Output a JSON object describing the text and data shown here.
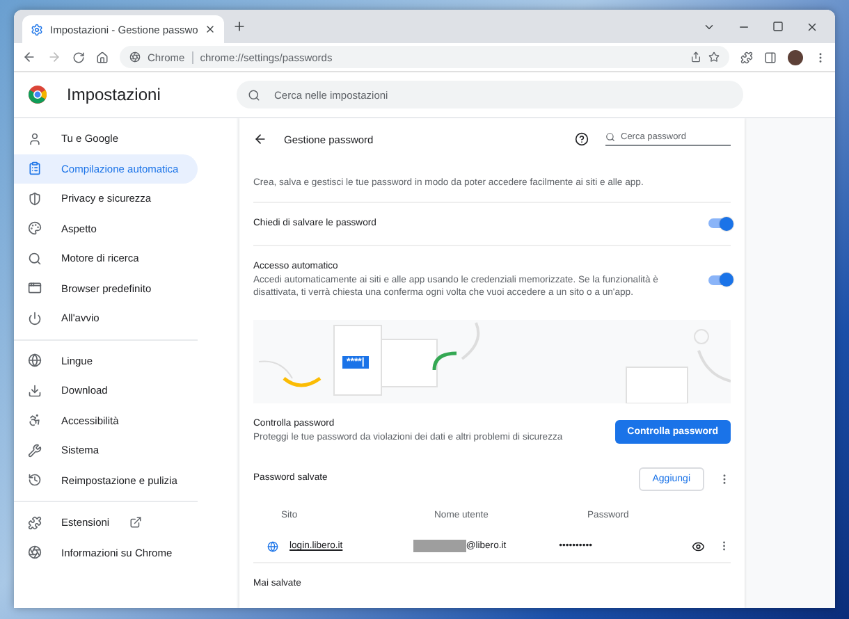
{
  "window": {
    "tab_title": "Impostazioni - Gestione passwo",
    "address_chip": "Chrome",
    "url": "chrome://settings/passwords"
  },
  "settings_header": {
    "title": "Impostazioni",
    "search_placeholder": "Cerca nelle impostazioni"
  },
  "sidebar": {
    "groups": [
      [
        {
          "label": "Tu e Google",
          "selected": false,
          "external": false
        },
        {
          "label": "Compilazione automatica",
          "selected": true,
          "external": false
        },
        {
          "label": "Privacy e sicurezza",
          "selected": false,
          "external": false
        },
        {
          "label": "Aspetto",
          "selected": false,
          "external": false
        },
        {
          "label": "Motore di ricerca",
          "selected": false,
          "external": false
        },
        {
          "label": "Browser predefinito",
          "selected": false,
          "external": false
        },
        {
          "label": "All'avvio",
          "selected": false,
          "external": false
        }
      ],
      [
        {
          "label": "Lingue",
          "selected": false,
          "external": false
        },
        {
          "label": "Download",
          "selected": false,
          "external": false
        },
        {
          "label": "Accessibilità",
          "selected": false,
          "external": false
        },
        {
          "label": "Sistema",
          "selected": false,
          "external": false
        },
        {
          "label": "Reimpostazione e pulizia",
          "selected": false,
          "external": false
        }
      ],
      [
        {
          "label": "Estensioni",
          "selected": false,
          "external": true
        },
        {
          "label": "Informazioni su Chrome",
          "selected": false,
          "external": false
        }
      ]
    ]
  },
  "page": {
    "title": "Gestione password",
    "search_placeholder": "Cerca password",
    "description": "Crea, salva e gestisci le tue password in modo da poter accedere facilmente ai siti e alle app.",
    "settings": [
      {
        "label": "Chiedi di salvare le password",
        "on": true
      },
      {
        "label": "Accesso automatico",
        "description": "Accedi automaticamente ai siti e alle app usando le credenziali memorizzate. Se la funzionalità è disattivata, ti verrà chiesta una conferma ogni volta che vuoi accedere a un sito o a un'app.",
        "on": true
      }
    ],
    "banner_text": "****|",
    "check": {
      "title": "Controlla password",
      "description": "Proteggi le tue password da violazioni dei dati e altri problemi di sicurezza",
      "button": "Controlla password"
    },
    "saved": {
      "title": "Password salvate",
      "add_button": "Aggiungi",
      "columns": [
        "Sito",
        "Nome utente",
        "Password"
      ],
      "rows": [
        {
          "site": "login.libero.it",
          "username": "@libero.it",
          "password": "••••••••••"
        }
      ]
    },
    "never_saved_title": "Mai salvate"
  }
}
